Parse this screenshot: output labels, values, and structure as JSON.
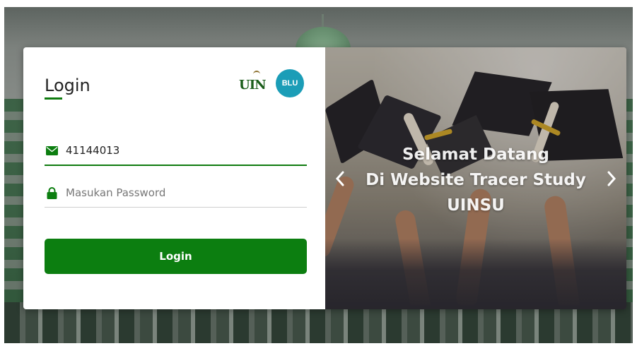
{
  "login": {
    "title": "Login",
    "username_value": "41144013",
    "password_placeholder": "Masukan Password",
    "button_label": "Login"
  },
  "logos": {
    "uin_text": "UIN",
    "blu_text": "BLU"
  },
  "carousel": {
    "line1": "Selamat Datang",
    "line2": "Di Website Tracer Study",
    "line3": "UINSU"
  },
  "colors": {
    "accent": "#0c7e10",
    "blu": "#1b9db7"
  }
}
